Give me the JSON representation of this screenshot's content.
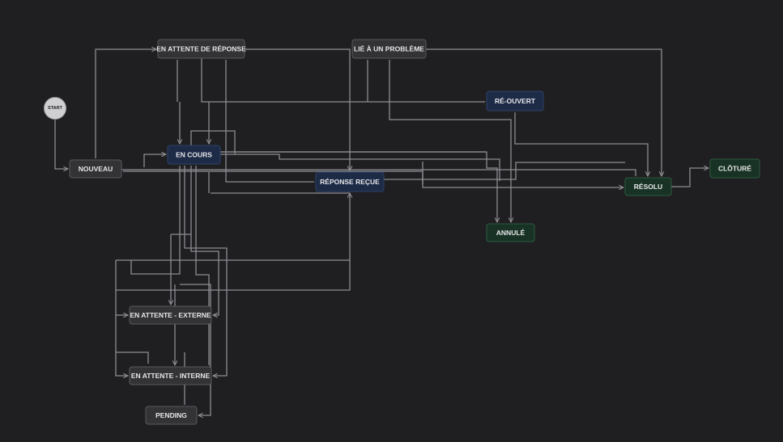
{
  "diagram": {
    "start_label": "START",
    "colors": {
      "background": "#1f1f22",
      "edge": "#8d8d92",
      "node_default_fill": "#333336",
      "node_default_stroke": "#5a5a5e",
      "node_active_fill": "#1d2b47",
      "node_active_stroke": "#2f4266",
      "node_done_fill": "#183325",
      "node_done_stroke": "#2e5a40",
      "node_done_text": "#cfe9d8",
      "start_fill": "#d0d0d3"
    },
    "nodes": [
      {
        "id": "nouveau",
        "label": "NOUVEAU",
        "kind": "default"
      },
      {
        "id": "en-cours",
        "label": "EN COURS",
        "kind": "active"
      },
      {
        "id": "en-attente-reponse",
        "label": "EN ATTENTE DE RÉPONSE",
        "kind": "default"
      },
      {
        "id": "lie-probleme",
        "label": "LIÉ À UN PROBLÈME",
        "kind": "default"
      },
      {
        "id": "re-ouvert",
        "label": "RÉ-OUVERT",
        "kind": "active"
      },
      {
        "id": "reponse-recue",
        "label": "RÉPONSE REÇUE",
        "kind": "active"
      },
      {
        "id": "resolu",
        "label": "RÉSOLU",
        "kind": "done"
      },
      {
        "id": "cloture",
        "label": "CLÔTURÉ",
        "kind": "done"
      },
      {
        "id": "annule",
        "label": "ANNULÉ",
        "kind": "done"
      },
      {
        "id": "en-attente-externe",
        "label": "EN ATTENTE - EXTERNE",
        "kind": "default"
      },
      {
        "id": "en-attente-interne",
        "label": "EN ATTENTE - INTERNE",
        "kind": "default"
      },
      {
        "id": "pending",
        "label": "PENDING",
        "kind": "default"
      }
    ]
  }
}
